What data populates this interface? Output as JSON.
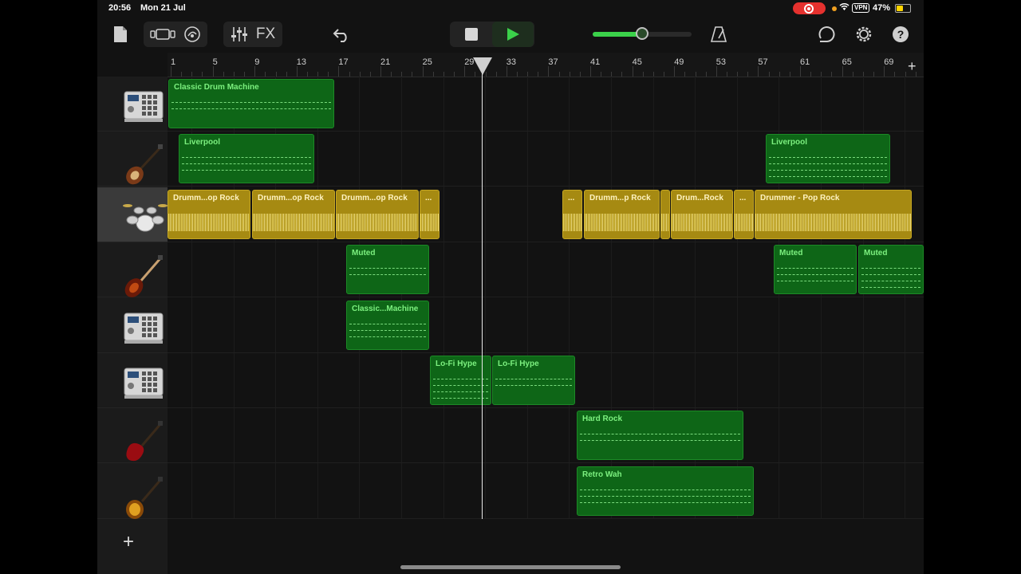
{
  "status_bar": {
    "time": "20:56",
    "date": "Mon 21 Jul",
    "vpn": "VPN",
    "battery_pct": "47%",
    "battery_level": 0.47
  },
  "toolbar": {
    "fx_label": "FX",
    "icons": [
      "document-icon",
      "track-view-icon",
      "browser-loop-icon",
      "mixer-icon",
      "undo-icon",
      "stop-icon",
      "play-icon",
      "master-volume-slider",
      "metronome-icon",
      "loop-browser-icon",
      "settings-gear-icon",
      "help-icon"
    ],
    "volume_level": 0.5,
    "accent": "#3bd14a"
  },
  "ruler": {
    "bars": [
      "1",
      "5",
      "9",
      "13",
      "17",
      "21",
      "25",
      "29",
      "33",
      "37",
      "41",
      "45",
      "49",
      "53",
      "57",
      "61",
      "65",
      "69"
    ],
    "add_label": "+"
  },
  "tracks": [
    {
      "instrument": "drum-machine-icon",
      "regions": [
        {
          "label": "Classic Drum Machine",
          "type": "midi"
        }
      ]
    },
    {
      "instrument": "bass-guitar-icon",
      "regions": [
        {
          "label": "Liverpool",
          "type": "midi"
        },
        {
          "label": "Liverpool",
          "type": "midi"
        }
      ]
    },
    {
      "instrument": "drum-kit-icon",
      "selected": true,
      "regions": [
        {
          "label": "Drumm...op Rock",
          "type": "drummer"
        },
        {
          "label": "Drumm...op Rock",
          "type": "drummer"
        },
        {
          "label": "Drumm...op Rock",
          "type": "drummer"
        },
        {
          "label": "...",
          "type": "drummer"
        },
        {
          "label": "...",
          "type": "drummer"
        },
        {
          "label": "Drumm...p Rock",
          "type": "drummer"
        },
        {
          "label": "",
          "type": "drummer"
        },
        {
          "label": "Drum...Rock",
          "type": "drummer"
        },
        {
          "label": "...",
          "type": "drummer"
        },
        {
          "label": "Drummer - Pop Rock",
          "type": "drummer"
        }
      ]
    },
    {
      "instrument": "electric-bass-icon",
      "regions": [
        {
          "label": "Muted",
          "type": "midi"
        },
        {
          "label": "Muted",
          "type": "midi"
        },
        {
          "label": "Muted",
          "type": "midi"
        }
      ]
    },
    {
      "instrument": "drum-machine-icon",
      "regions": [
        {
          "label": "Classic...Machine",
          "type": "midi"
        }
      ]
    },
    {
      "instrument": "drum-machine-icon",
      "regions": [
        {
          "label": "Lo-Fi Hype",
          "type": "midi"
        },
        {
          "label": "Lo-Fi Hype",
          "type": "midi"
        }
      ]
    },
    {
      "instrument": "red-electric-guitar-icon",
      "regions": [
        {
          "label": "Hard Rock",
          "type": "midi"
        }
      ]
    },
    {
      "instrument": "sunburst-guitar-icon",
      "regions": [
        {
          "label": "Retro Wah",
          "type": "midi"
        }
      ]
    }
  ],
  "add_track_label": "+"
}
